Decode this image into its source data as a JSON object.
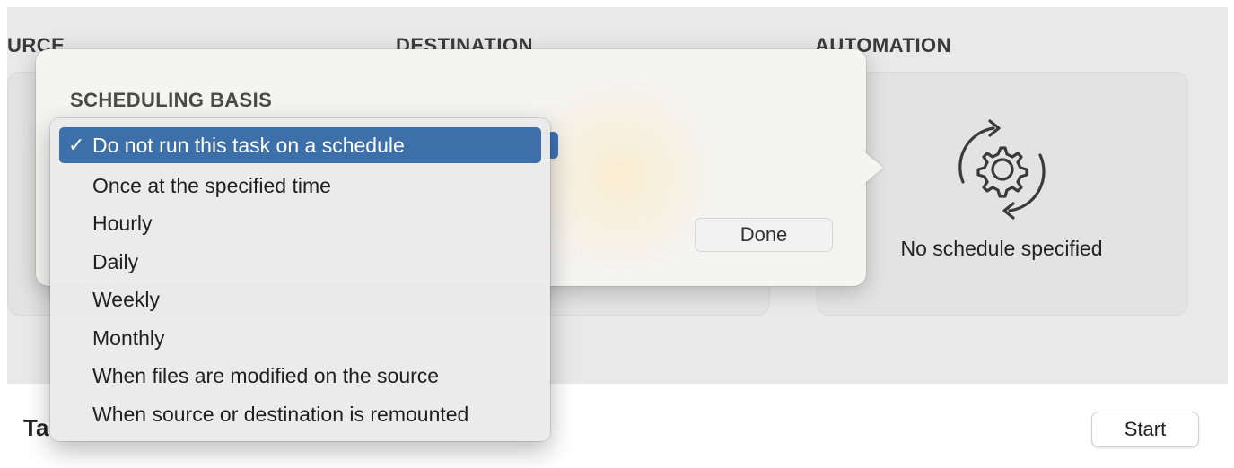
{
  "columns": {
    "source": "URCE",
    "destination": "DESTINATION",
    "automation": "AUTOMATION"
  },
  "automation_card": {
    "status": "No schedule specified",
    "icon": "gear-sync-icon"
  },
  "popover": {
    "section_label": "SCHEDULING BASIS",
    "done_label": "Done"
  },
  "menu": {
    "checkmark": "✓",
    "items": [
      {
        "label": "Do not run this task on a schedule",
        "selected": true
      },
      {
        "label": "Once at the specified time"
      },
      {
        "label": "Hourly"
      },
      {
        "label": "Daily"
      },
      {
        "label": "Weekly"
      },
      {
        "label": "Monthly"
      },
      {
        "label": "When files are modified on the source"
      },
      {
        "label": "When source or destination is remounted"
      }
    ]
  },
  "bottom": {
    "task_title": "Ta",
    "start_label": "Start"
  },
  "colors": {
    "selection": "#3d6fa8",
    "background": "#e9e9e9"
  }
}
